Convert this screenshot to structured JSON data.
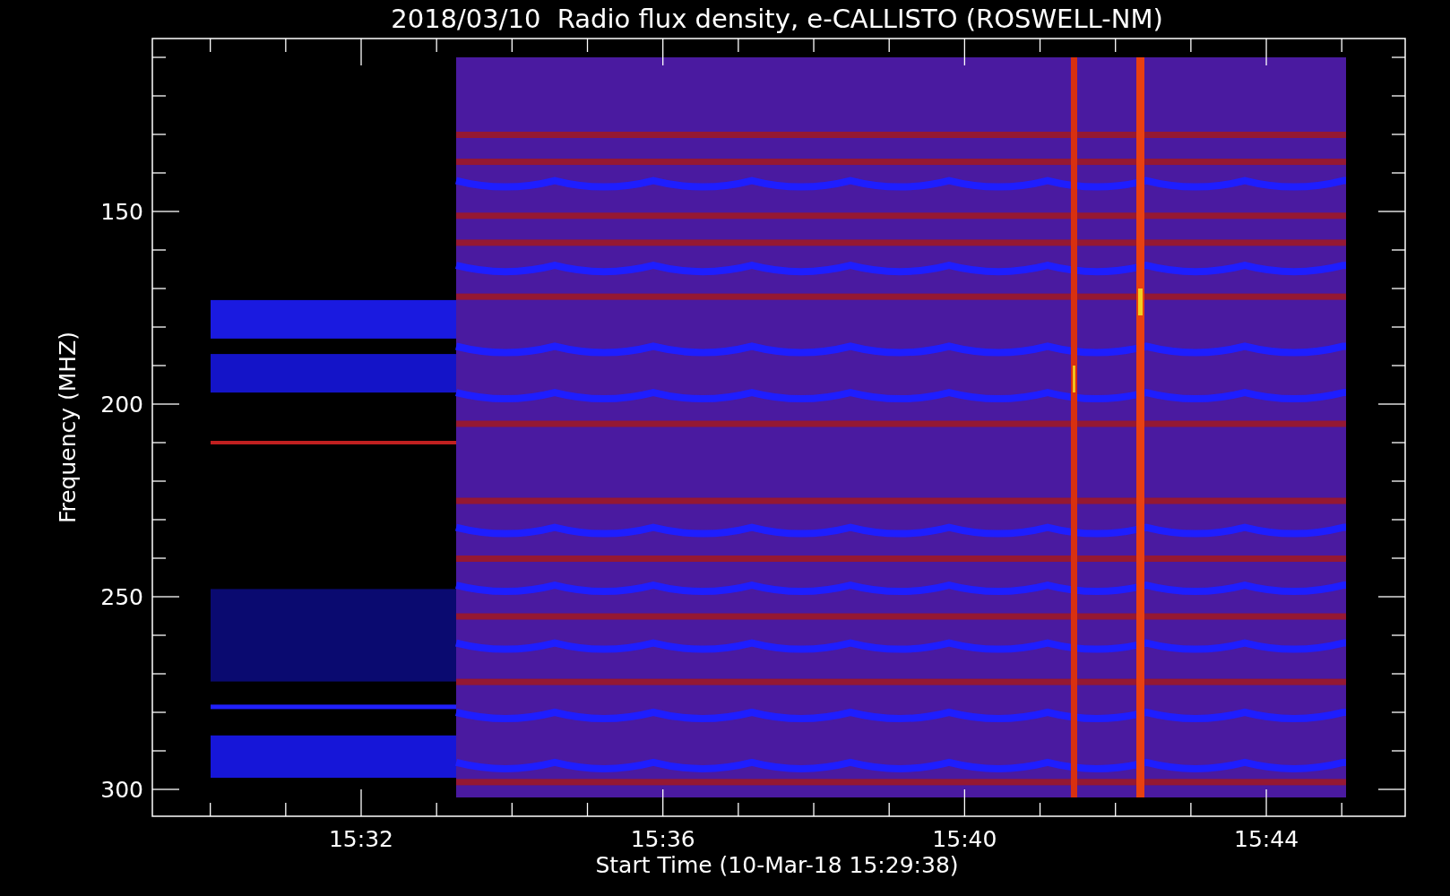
{
  "title": "2018/03/10  Radio flux density, e-CALLISTO (ROSWELL-NM)",
  "y_axis": {
    "label": "Frequency (MHZ)",
    "ticks": [
      "150",
      "200",
      "250",
      "300"
    ]
  },
  "x_axis": {
    "label": "Start Time (10-Mar-18 15:29:38)",
    "ticks": [
      "15:32",
      "15:36",
      "15:40",
      "15:44"
    ]
  }
}
